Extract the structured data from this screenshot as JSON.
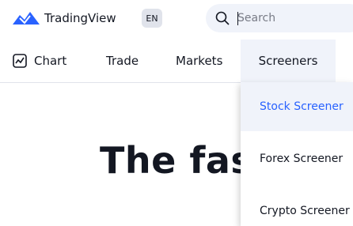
{
  "header": {
    "logo_text": "TradingView",
    "lang_label": "EN",
    "search": {
      "placeholder": "Search",
      "icon": "search-icon"
    }
  },
  "nav": {
    "items": [
      {
        "label": "Chart",
        "icon": "chart-icon"
      },
      {
        "label": "Trade"
      },
      {
        "label": "Markets"
      },
      {
        "label": "Screeners",
        "active": true
      }
    ]
  },
  "hero": {
    "title": "The fast"
  },
  "dropdown": {
    "items": [
      {
        "label": "Stock Screener",
        "active": true
      },
      {
        "label": "Forex Screener"
      },
      {
        "label": "Crypto Screener"
      }
    ]
  },
  "colors": {
    "accent": "#2962ff",
    "hover_bg": "#f0f3fa",
    "text": "#131722"
  }
}
